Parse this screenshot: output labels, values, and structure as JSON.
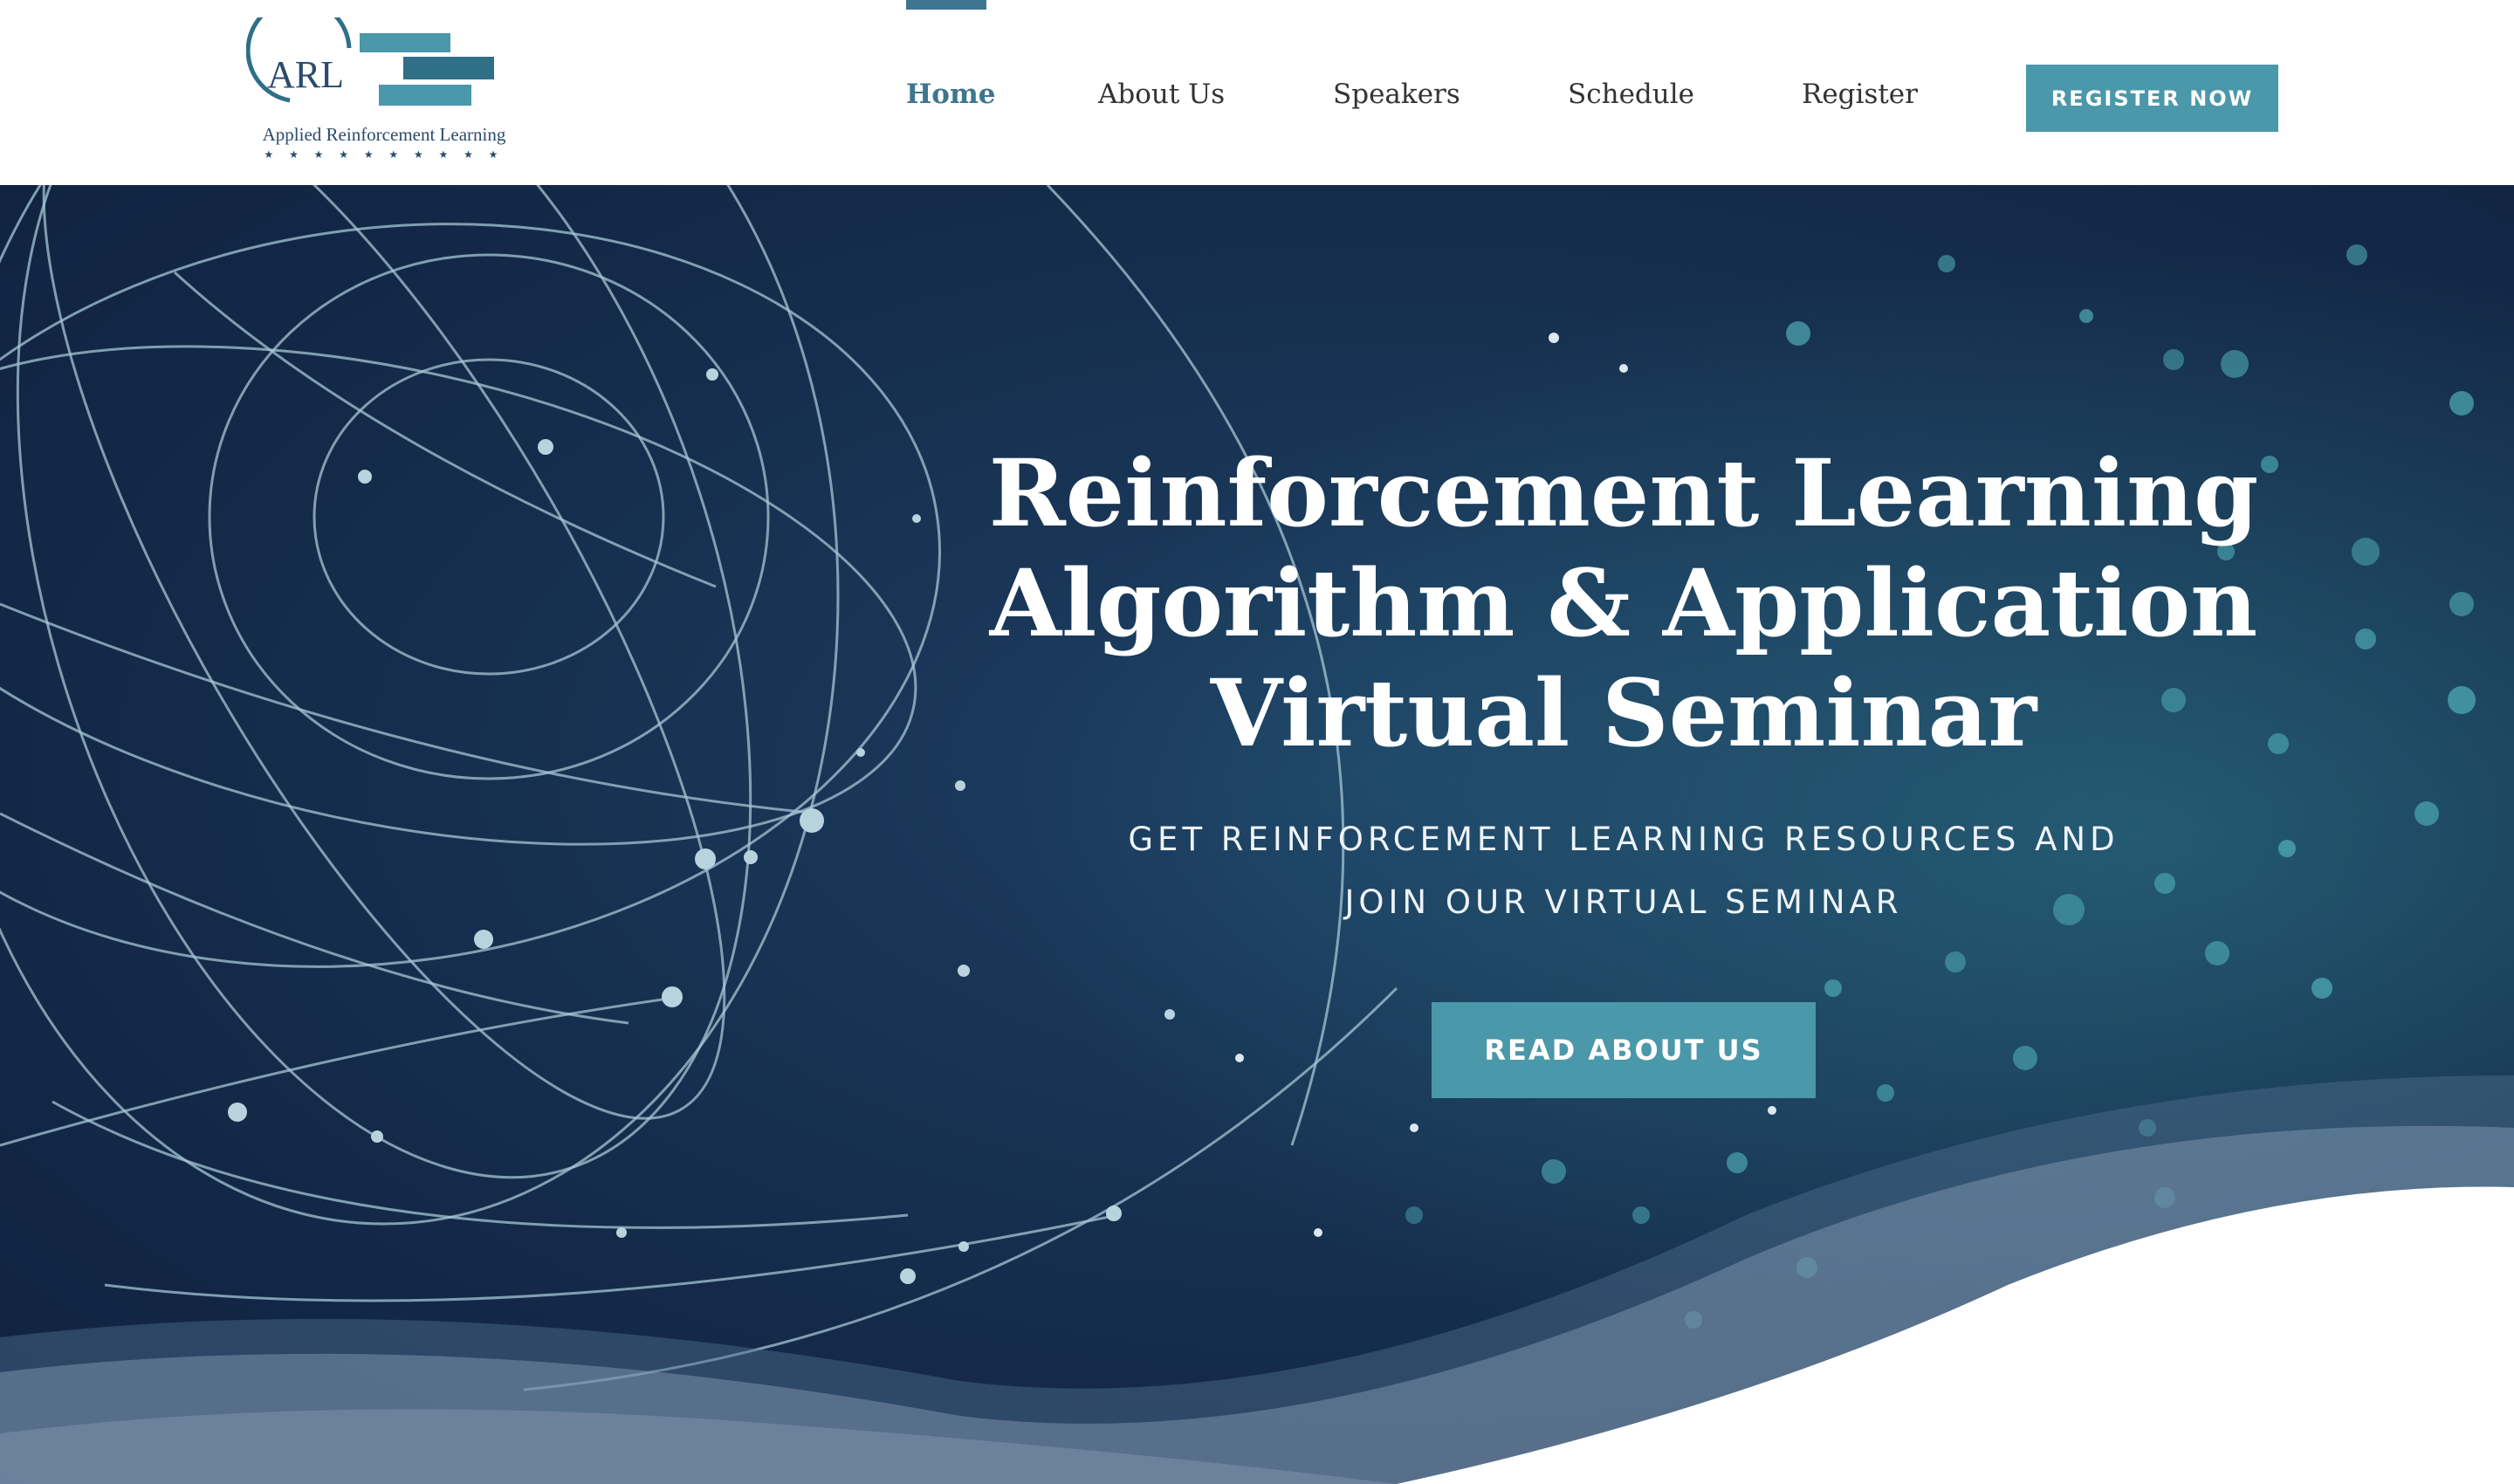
{
  "logo": {
    "mark_text": "ARL",
    "tagline": "Applied Reinforcement Learning",
    "stars": "★ ★ ★ ★ ★ ★ ★ ★ ★ ★"
  },
  "nav": {
    "items": [
      {
        "label": "Home",
        "active": true
      },
      {
        "label": "About Us",
        "active": false
      },
      {
        "label": "Speakers",
        "active": false
      },
      {
        "label": "Schedule",
        "active": false
      },
      {
        "label": "Register",
        "active": false
      }
    ],
    "cta_label": "REGISTER NOW"
  },
  "hero": {
    "title": "Reinforcement Learning\nAlgorithm & Application\nVirtual Seminar",
    "subtitle": "GET REINFORCEMENT LEARNING RESOURCES AND\nJOIN OUR VIRTUAL SEMINAR",
    "button_label": "READ ABOUT US"
  },
  "colors": {
    "accent": "#4a98aa",
    "active_nav": "#3e7590",
    "hero_background": "#162d4c",
    "nav_text": "#333333"
  }
}
